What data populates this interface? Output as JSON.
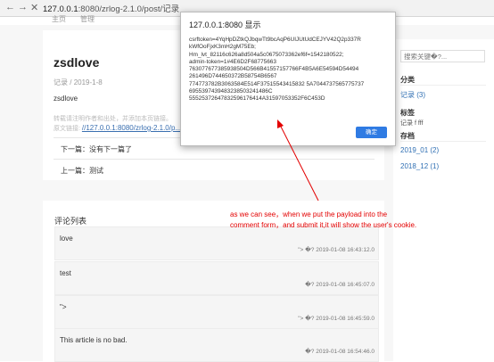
{
  "browser": {
    "back_icon": "arrow-left-icon",
    "forward_icon": "arrow-right-icon",
    "close_icon": "close-icon",
    "url_host": "127.0.0.1",
    "url_rest": ":8080/zrlog-2.1.0/post/记录"
  },
  "topnav": {
    "home": "主页",
    "manage": "管理"
  },
  "post": {
    "title": "zsdlove",
    "category": "记录",
    "date_sep": "/",
    "date": "2019-1-8",
    "body": "zsdlove",
    "copyright_line1": "转载请注明作者和出处，并添加本页链接。",
    "copyright_label": "原文链接:",
    "copyright_link": "//127.0.0.1:8080/zrlog-2.1.0/p...",
    "next": "下一篇：没有下一篇了",
    "prev": "上一篇：测试"
  },
  "comments": {
    "title": "评论列表",
    "items": [
      {
        "text": "love",
        "time": "\"> �? 2019-01-08 16:43:12.0"
      },
      {
        "text": "test",
        "time": "�? 2019-01-08 16:45:07.0"
      },
      {
        "text": "\">",
        "time": "\"> �? 2019-01-08 16:45:59.0"
      },
      {
        "text": "This article is no bad.",
        "time": "�? 2019-01-08 16:54:46.0"
      }
    ]
  },
  "sidebar": {
    "search_placeholder": "搜索关键�?...",
    "category_head": "分类",
    "category_link": "记录 (3)",
    "tag_head": "标签",
    "tag_text": "记录 f fff",
    "archive_head": "存档",
    "archives": [
      "2019_01 (2)",
      "2018_12 (1)"
    ]
  },
  "dialog": {
    "title": "127.0.0.1:8080 显示",
    "lines": [
      "csrftoken=4YqHpDZtkQJbqwTt9bcAqP6UIJUtUdCEJYV42Q2p337R",
      "kWfOoFjxK3mH2gM75Eb;",
      "Hm_lvt_82116c626a8d504a5c0675073362ef6f=1542180522;",
      "admin-token=1#4E6D2F68775663",
      "763077677385938504D566B41557157766F4B5A6E54594D54494",
      "261496D744650372B58754B6567",
      "774773782B3063584E514F37515543415832 5A7044737565775737",
      "6955397439483238503241486C",
      "55525372647832596176414A31597053352F6C453D"
    ],
    "ok": "确定"
  },
  "annotation": {
    "line1": "as we  can see，when we put the payload into the",
    "line2": "comment form，and submit it,it will show the user's cookie."
  },
  "colors": {
    "annotation": "#e30000",
    "link": "#2f6fb3",
    "ok_button": "#2f7be3"
  }
}
